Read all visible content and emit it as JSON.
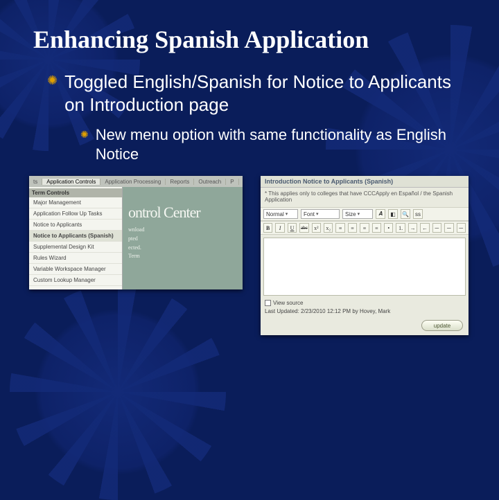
{
  "title": "Enhancing Spanish Application",
  "bullet1": "Toggled English/Spanish for Notice to Applicants on Introduction page",
  "bullet2": "New menu option with same functionality as English Notice",
  "menu": {
    "tabs": [
      "ts",
      "Application Controls",
      "Application Processing",
      "Reports",
      "Outreach",
      "P"
    ],
    "active_tab_index": 1,
    "header": "Term Controls",
    "items": [
      "Major Management",
      "Application Follow Up Tasks",
      "Notice to Applicants",
      "Notice to Applicants (Spanish)",
      "Supplemental Design Kit",
      "Rules Wizard",
      "Variable Workspace Manager",
      "Custom Lookup Manager"
    ],
    "selected_index": 3,
    "preview_big": "ontrol Center",
    "preview_lines": [
      "wnload",
      "pted",
      "ected.",
      "",
      "Term"
    ]
  },
  "editor": {
    "title": "Introduction Notice to Applicants (Spanish)",
    "subtitle": "* This applies only to colleges that have CCCApply en Español / the Spanish Application",
    "style_sel": "Normal",
    "font_sel": "Font",
    "size_sel": "Size",
    "bar1_icons": [
      "t1",
      "t2",
      "t3",
      "t4",
      "ss"
    ],
    "bar2_icons": [
      "B",
      "I",
      "U",
      "abc",
      "x²",
      "x₂",
      "≡",
      "≡",
      "≡",
      "≡",
      "•",
      "1.",
      "→",
      "←",
      "─",
      "─",
      "─"
    ],
    "view_source": "View source",
    "last_updated": "Last Updated: 2/23/2010 12:12 PM by Hovey, Mark",
    "update_btn": "update"
  }
}
